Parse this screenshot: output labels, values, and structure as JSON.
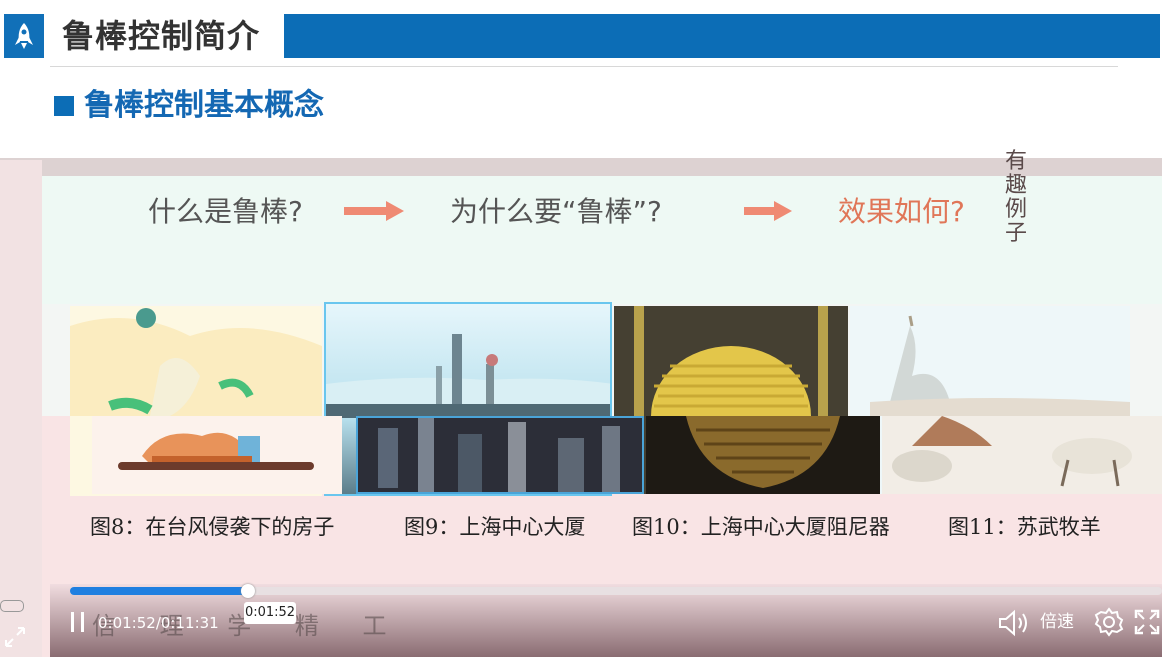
{
  "header": {
    "title": "鲁棒控制简介",
    "section_title": "鲁棒控制基本概念",
    "logo_icon": "rocket-icon",
    "accent_color": "#0c6db6"
  },
  "questions": {
    "q1": "什么是鲁棒?",
    "q2": "为什么要“鲁棒”?",
    "q3": "效果如何?",
    "side_note": "有趣例子"
  },
  "figures": [
    {
      "caption": "图8：在台风侵袭下的房子"
    },
    {
      "caption": "图9：上海中心大厦"
    },
    {
      "caption": "图10：上海中心大厦阻尼器"
    },
    {
      "caption": "图11：苏武牧羊"
    }
  ],
  "player": {
    "current_time": "0:01:52",
    "total_time": "0:11:31",
    "time_display": "0:01:52/0:11:31",
    "tooltip": "0:01:52",
    "speed_label": "倍速",
    "progress": 0.162,
    "watermark": "信 理 学 精 工",
    "progress_color": "#1f7fe0"
  }
}
